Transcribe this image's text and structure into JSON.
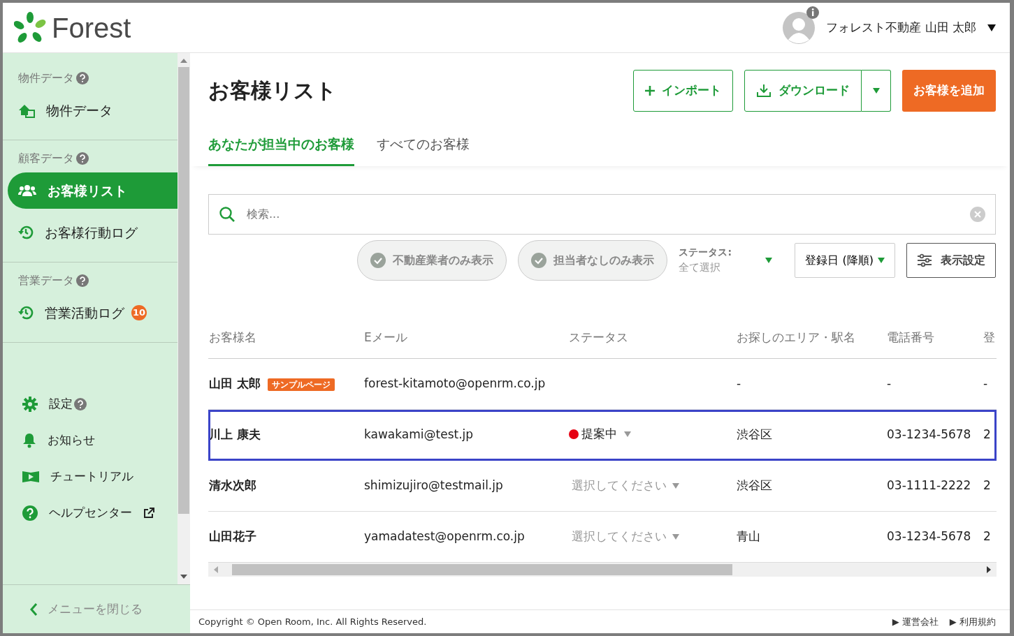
{
  "header": {
    "logo_text": "Forest",
    "user_name": "フォレスト不動産 山田 太郎"
  },
  "sidebar": {
    "sections": [
      {
        "heading": "物件データ",
        "help": true,
        "items": [
          {
            "label": "物件データ",
            "selected": false
          }
        ]
      },
      {
        "heading": "顧客データ",
        "help": true,
        "items": [
          {
            "label": "お客様リスト",
            "selected": true
          },
          {
            "label": "お客様行動ログ",
            "selected": false
          }
        ]
      },
      {
        "heading": "営業データ",
        "help": true,
        "items": [
          {
            "label": "営業活動ログ",
            "selected": false,
            "badge": "10"
          }
        ]
      }
    ],
    "bottom_items": [
      {
        "label": "設定",
        "help": true,
        "external": false
      },
      {
        "label": "お知らせ",
        "help": false,
        "external": false
      },
      {
        "label": "チュートリアル",
        "help": false,
        "external": false
      },
      {
        "label": "ヘルプセンター",
        "help": false,
        "external": true
      }
    ],
    "close_label": "メニューを閉じる"
  },
  "page": {
    "title": "お客様リスト",
    "buttons": [
      {
        "kind": "import",
        "label": "インポート"
      },
      {
        "kind": "download",
        "label": "ダウンロード"
      },
      {
        "kind": "add",
        "label": "お客様を追加"
      }
    ],
    "tabs": [
      {
        "label": "あなたが担当中のお客様",
        "selected": true
      },
      {
        "label": "すべてのお客様",
        "selected": false
      }
    ]
  },
  "search": {
    "placeholder": "検索..."
  },
  "filters": {
    "chips": [
      {
        "label": "不動産業者のみ表示",
        "on": false
      },
      {
        "label": "担当者なしのみ表示",
        "on": false
      }
    ],
    "status_label": "ステータス:",
    "status_value": "全て選択",
    "sort": "登録日 (降順)",
    "settings_label": "表示設定"
  },
  "table": {
    "columns": [
      "お客様名",
      "Eメール",
      "ステータス",
      "お探しのエリア・駅名",
      "電話番号",
      "登"
    ],
    "rows": [
      {
        "name": "山田 太郎",
        "tag": "サンプルページ",
        "email": "forest-kitamoto@openrm.co.jp",
        "status": {
          "kind": "none"
        },
        "area": "-",
        "phone": "-",
        "column_6": "-",
        "selected": false
      },
      {
        "name": "川上 康夫",
        "email": "kawakami@test.jp",
        "status": {
          "kind": "set",
          "label": "提案中",
          "color": "#e60012"
        },
        "area": "渋谷区",
        "phone": "03-1234-5678",
        "column_6": "2",
        "selected": true
      },
      {
        "name": "清水次郎",
        "email": "shimizujiro@testmail.jp",
        "status": {
          "kind": "placeholder",
          "label": "選択してください"
        },
        "area": "渋谷区",
        "phone": "03-1111-2222",
        "column_6": "2",
        "selected": false
      },
      {
        "name": "山田花子",
        "email": "yamadatest@openrm.co.jp",
        "status": {
          "kind": "placeholder",
          "label": "選択してください"
        },
        "area": "青山",
        "phone": "03-1234-5678",
        "column_6": "2",
        "selected": false
      }
    ]
  },
  "footer": {
    "copyright": "Copyright © Open Room, Inc. All Rights Reserved.",
    "links": [
      "▶ 運営会社",
      "▶ 利用規約"
    ]
  }
}
